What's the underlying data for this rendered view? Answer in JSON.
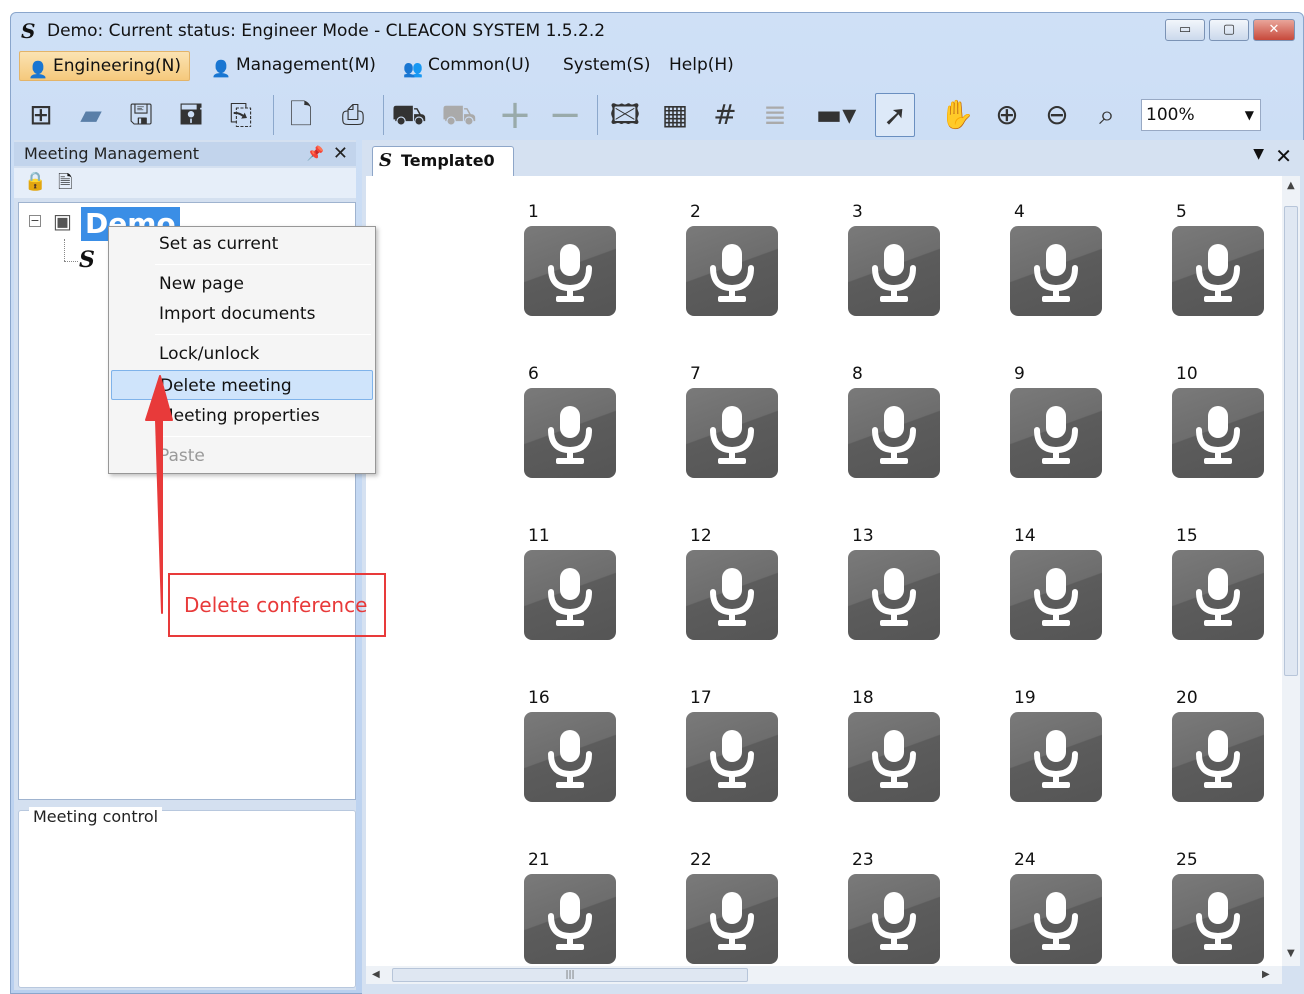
{
  "window": {
    "title": "Demo: Current status: Engineer Mode - CLEACON SYSTEM 1.5.2.2",
    "logo_glyph": "S",
    "minimize": "▭",
    "maximize": "▢",
    "close": "✕"
  },
  "menu": {
    "items": [
      {
        "label": "Engineering(N)",
        "icon": "engineer-user-icon"
      },
      {
        "label": "Management(M)",
        "icon": "manager-user-icon"
      },
      {
        "label": "Common(U)",
        "icon": "users-group-icon"
      },
      {
        "label": "System(S)"
      },
      {
        "label": "Help(H)"
      }
    ],
    "active": "Engineering(N)"
  },
  "toolbar": {
    "zoom": "100%",
    "icons": [
      "layout-icon",
      "open-folder-icon",
      "save-icon",
      "save-all-icon",
      "import-icon",
      "new-page-icon",
      "pdf-icon",
      "device-icon",
      "device-disabled-icon",
      "add-icon",
      "remove-icon",
      "background-image-icon",
      "grid-icon",
      "fine-grid-icon",
      "list-icon",
      "bar-icon",
      "pointer-icon",
      "hand-icon",
      "zoom-in-icon",
      "zoom-out-icon",
      "zoom-fit-icon"
    ]
  },
  "left_panel": {
    "title": "Meeting Management",
    "pin": "ᵖ",
    "close": "✕",
    "tree": {
      "root_label": "Demo",
      "child_logo": "S"
    },
    "meeting_control_label": "Meeting control"
  },
  "context_menu": {
    "items": [
      {
        "label": "Set as current",
        "state": "normal"
      },
      {
        "label": "New page",
        "state": "normal"
      },
      {
        "label": "Import documents",
        "state": "normal"
      },
      {
        "label": "Lock/unlock",
        "state": "normal"
      },
      {
        "label": "Delete meeting",
        "state": "hover"
      },
      {
        "label": "Meeting properties",
        "state": "normal"
      },
      {
        "label": "Paste",
        "state": "disabled"
      }
    ]
  },
  "annotation": {
    "text": "Delete conference",
    "color": "#e83a3a"
  },
  "document": {
    "tab_label": "Template0",
    "tab_logo": "S",
    "close": "✕",
    "seats": [
      "1",
      "2",
      "3",
      "4",
      "5",
      "6",
      "7",
      "8",
      "9",
      "10",
      "11",
      "12",
      "13",
      "14",
      "15",
      "16",
      "17",
      "18",
      "19",
      "20",
      "21",
      "22",
      "23",
      "24",
      "25"
    ],
    "seat_icon": "microphone-icon"
  },
  "colors": {
    "accent": "#3a8ee6",
    "menu_active": "#f5c97c",
    "tile": "#666666"
  }
}
